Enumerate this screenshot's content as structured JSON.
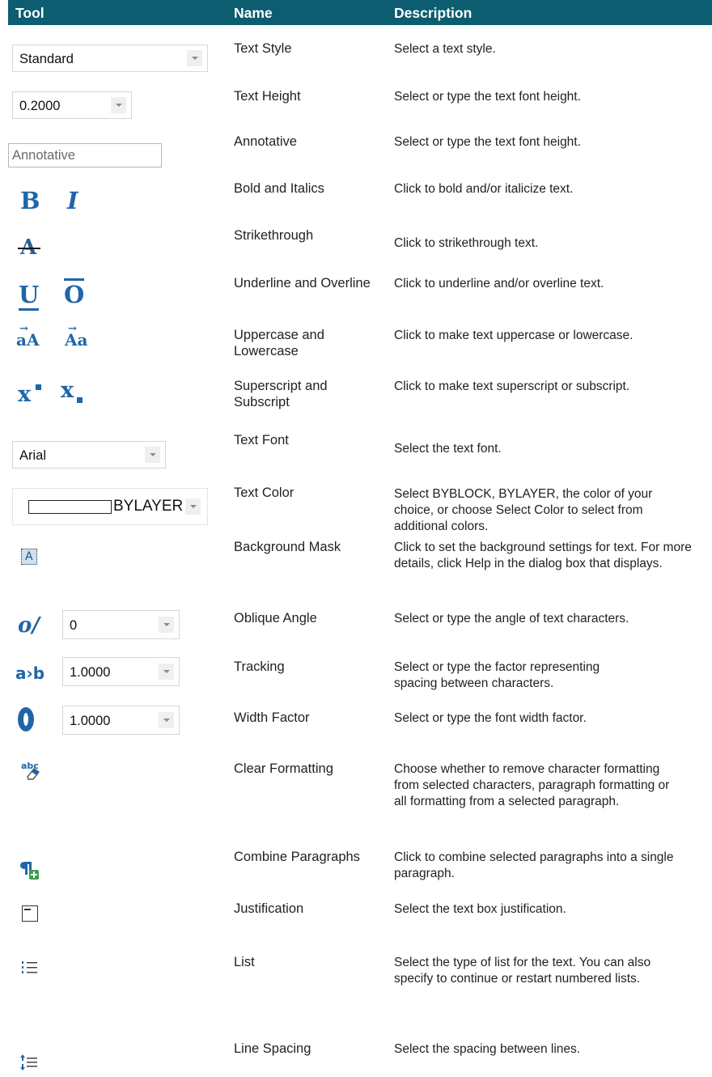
{
  "header": {
    "tool": "Tool",
    "name": "Name",
    "description": "Description"
  },
  "rows": [
    {
      "name": "Text Style",
      "description": "Select a text style."
    },
    {
      "name": "Text Height",
      "description": "Select or type the text font height."
    },
    {
      "name": "Annotative",
      "description": "Select or type the text font height."
    },
    {
      "name": "Bold and Italics",
      "description": "Click to bold and/or italicize text."
    },
    {
      "name": "Strikethrough",
      "description": "Click to strikethrough text."
    },
    {
      "name": "Underline and Overline",
      "description": "Click to underline and/or overline text."
    },
    {
      "name": "Uppercase and Lowercase",
      "description": "Click to make text uppercase or lowercase."
    },
    {
      "name": "Superscript and Subscript",
      "description": "Click to make text superscript or subscript."
    },
    {
      "name": "Text Font",
      "description": "Select the text font."
    },
    {
      "name": "Text Color",
      "description": "Select BYBLOCK, BYLAYER, the color of your choice, or choose Select Color to select from additional colors."
    },
    {
      "name": "Background Mask",
      "description": "Click to set the background settings for text. For more details, click Help in the dialog box that displays."
    },
    {
      "name": "Oblique Angle",
      "description": "Select or type the angle of text characters."
    },
    {
      "name": "Tracking",
      "description": "Select or type the factor representing spacing between characters."
    },
    {
      "name": "Width Factor",
      "description": "Select or type the font width factor."
    },
    {
      "name": "Clear Formatting",
      "description": "Choose whether to remove character formatting from selected characters, paragraph formatting or all formatting from a selected paragraph."
    },
    {
      "name": "Combine Paragraphs",
      "description": "Click to combine selected paragraphs into a single paragraph."
    },
    {
      "name": "Justification",
      "description": "Select the text box justification."
    },
    {
      "name": "List",
      "description": "Select the type of list for the text. You can also specify to continue or restart numbered lists."
    },
    {
      "name": "Line Spacing",
      "description": "Select the spacing between lines."
    }
  ],
  "tools": {
    "text_style_value": "Standard",
    "text_height_value": "0.2000",
    "annotative_label": "Annotative",
    "bold_glyph": "B",
    "italic_glyph": "I",
    "strike_glyph": "A",
    "underline_glyph": "U",
    "overline_glyph": "O",
    "uppercase_glyph": "aA",
    "lowercase_glyph": "Aa",
    "superscript_glyph": "x",
    "subscript_glyph": "x",
    "font_value": "Arial",
    "color_value": "BYLAYER",
    "mask_glyph": "A",
    "oblique_value": "0",
    "tracking_value": "1.0000",
    "width_value": "1.0000",
    "clear_glyph": "abc"
  }
}
